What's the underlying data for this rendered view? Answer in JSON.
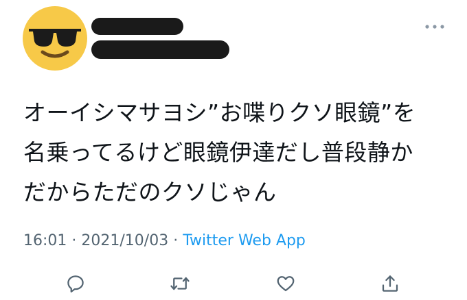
{
  "tweet": {
    "avatar_icon": "sunglasses-smiley-icon",
    "more_icon": "ellipsis-icon",
    "text_lines": [
      "オーイシマサヨシ”お喋りクソ眼鏡”を",
      "名乗ってるけど眼鏡伊達だし普段静か",
      "だからただのクソじゃん"
    ],
    "time": "16:01",
    "date": "2021/10/03",
    "separator": "·",
    "source": "Twitter Web App",
    "actions": {
      "reply_icon": "reply-icon",
      "retweet_icon": "retweet-icon",
      "like_icon": "heart-icon",
      "share_icon": "share-icon"
    },
    "colors": {
      "text": "#0f1419",
      "meta": "#536471",
      "link": "#1d9bf0",
      "redaction": "#1a1a1a"
    }
  }
}
